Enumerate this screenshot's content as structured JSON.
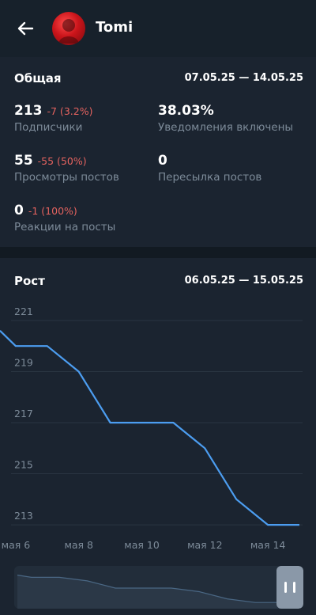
{
  "header": {
    "channel_name": "Tomi"
  },
  "overview": {
    "title": "Общая",
    "date_range": "07.05.25 — 14.05.25",
    "stats": [
      {
        "value": "213",
        "delta": "-7 (3.2%)",
        "label": "Подписчики"
      },
      {
        "value": "38.03%",
        "delta": "",
        "label": "Уведомления включены"
      },
      {
        "value": "55",
        "delta": "-55 (50%)",
        "label": "Просмотры постов"
      },
      {
        "value": "0",
        "delta": "",
        "label": "Пересылка постов"
      },
      {
        "value": "0",
        "delta": "-1 (100%)",
        "label": "Реакции на посты"
      }
    ]
  },
  "growth": {
    "title": "Рост",
    "date_range": "06.05.25 — 15.05.25"
  },
  "colors": {
    "background": "#17212b",
    "card": "#1b2430",
    "line": "#4c9df0",
    "negative": "#e5635f",
    "muted": "#7d8b99"
  },
  "chart_data": {
    "type": "line",
    "title": "Рост",
    "x_tick_labels": [
      "мая 6",
      "мая 8",
      "мая 10",
      "мая 12",
      "мая 14"
    ],
    "y_tick_labels": [
      "221",
      "219",
      "217",
      "215",
      "213"
    ],
    "ylim": [
      212.6,
      221.4
    ],
    "grid": true,
    "series": [
      {
        "x": [
          5.5,
          6,
          7,
          8,
          9,
          10,
          11,
          12,
          13,
          14,
          15
        ],
        "values": [
          220.6,
          220,
          220,
          219,
          217,
          217,
          217,
          216,
          214,
          213,
          213
        ]
      }
    ]
  }
}
